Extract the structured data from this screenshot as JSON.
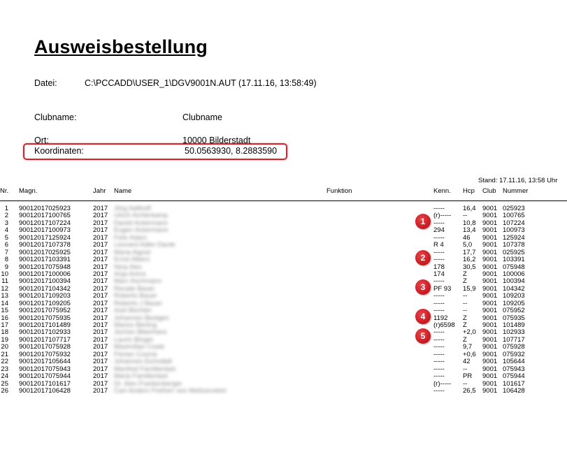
{
  "document": {
    "title": "Ausweisbestellung",
    "datei_label": "Datei:",
    "datei_value": "C:\\PCCADD\\USER_1\\DGV9001N.AUT (17.11.16, 13:58:49)",
    "clubname_label": "Clubname:",
    "clubname_value": "Clubname",
    "ort_label": "Ort:",
    "ort_value": "10000 Bilderstadt",
    "koordinaten_label": "Koordinaten:",
    "koordinaten_value": "50.0563930, 8.2883590",
    "stand": "Stand: 17.11.16, 13:58 Uhr"
  },
  "highlight_color": "#d8222a",
  "table": {
    "headers": {
      "nr": "Nr.",
      "magn": "Magn.",
      "jahr": "Jahr",
      "name": "Name",
      "funktion": "Funktion",
      "kenn": "Kenn.",
      "hcp": "Hcp",
      "club": "Club",
      "nummer": "Nummer"
    },
    "rows": [
      {
        "nr": "1",
        "magn": "90012017025923",
        "jahr": "2017",
        "name": "Jörg Aalthoff",
        "kenn": "-----",
        "hcp": "16,4",
        "club": "9001",
        "nummer": "025923"
      },
      {
        "nr": "2",
        "magn": "90012017100765",
        "jahr": "2017",
        "name": "Ulrich Achterkamp",
        "kenn": "(r)-----",
        "hcp": "--",
        "club": "9001",
        "nummer": "100765"
      },
      {
        "nr": "3",
        "magn": "90012017107224",
        "jahr": "2017",
        "name": "Daniel Ackermann",
        "kenn": "-----",
        "hcp": "10,8",
        "club": "9001",
        "nummer": "107224"
      },
      {
        "nr": "4",
        "magn": "90012017100973",
        "jahr": "2017",
        "name": "Eugen Ackermann",
        "kenn": "294",
        "hcp": "13,4",
        "club": "9001",
        "nummer": "100973"
      },
      {
        "nr": "5",
        "magn": "90012017125924",
        "jahr": "2017",
        "name": "Felix Adam",
        "kenn": "-----",
        "hcp": "46",
        "club": "9001",
        "nummer": "125924"
      },
      {
        "nr": "6",
        "magn": "90012017107378",
        "jahr": "2017",
        "name": "Leonard Adler-Dante",
        "kenn": "R 4",
        "hcp": "5,0",
        "club": "9001",
        "nummer": "107378"
      },
      {
        "nr": "7",
        "magn": "90012017025925",
        "jahr": "2017",
        "name": "Maria Aigner",
        "kenn": "-----",
        "hcp": "17,7",
        "club": "9001",
        "nummer": "025925"
      },
      {
        "nr": "8",
        "magn": "90012017103391",
        "jahr": "2017",
        "name": "Ernst Albers",
        "kenn": "-----",
        "hcp": "16,2",
        "club": "9001",
        "nummer": "103391"
      },
      {
        "nr": "9",
        "magn": "90012017075948",
        "jahr": "2017",
        "name": "Nina Alex",
        "kenn": "178",
        "hcp": "30,5",
        "club": "9001",
        "nummer": "075948"
      },
      {
        "nr": "10",
        "magn": "90012017100006",
        "jahr": "2017",
        "name": "Anja Arens",
        "kenn": "174",
        "hcp": "Z",
        "club": "9001",
        "nummer": "100006"
      },
      {
        "nr": "11",
        "magn": "90012017100394",
        "jahr": "2017",
        "name": "Marc Aschmann",
        "kenn": "-----",
        "hcp": "Z",
        "club": "9001",
        "nummer": "100394"
      },
      {
        "nr": "12",
        "magn": "90012017104342",
        "jahr": "2017",
        "name": "Renate Bauer",
        "kenn": "PF 93",
        "hcp": "15,9",
        "club": "9001",
        "nummer": "104342"
      },
      {
        "nr": "13",
        "magn": "90012017109203",
        "jahr": "2017",
        "name": "Roberto Bauer",
        "kenn": "-----",
        "hcp": "--",
        "club": "9001",
        "nummer": "109203"
      },
      {
        "nr": "14",
        "magn": "90012017109205",
        "jahr": "2017",
        "name": "Roberto J Bauer",
        "kenn": "-----",
        "hcp": "--",
        "club": "9001",
        "nummer": "109205"
      },
      {
        "nr": "15",
        "magn": "90012017075952",
        "jahr": "2017",
        "name": "Axel Bechter",
        "kenn": "-----",
        "hcp": "--",
        "club": "9001",
        "nummer": "075952"
      },
      {
        "nr": "16",
        "magn": "90012017075935",
        "jahr": "2017",
        "name": "Johannes Beelgen",
        "kenn": "1192",
        "hcp": "Z",
        "club": "9001",
        "nummer": "075935"
      },
      {
        "nr": "17",
        "magn": "90012017101489",
        "jahr": "2017",
        "name": "Marion Berling",
        "kenn": "(r)6598",
        "hcp": "Z",
        "club": "9001",
        "nummer": "101489"
      },
      {
        "nr": "18",
        "magn": "90012017102933",
        "jahr": "2017",
        "name": "Jochen Bikerhans",
        "kenn": "-----",
        "hcp": "+2,0",
        "club": "9001",
        "nummer": "102933"
      },
      {
        "nr": "19",
        "magn": "90012017107717",
        "jahr": "2017",
        "name": "Laurin Binger",
        "kenn": "-----",
        "hcp": "Z",
        "club": "9001",
        "nummer": "107717"
      },
      {
        "nr": "20",
        "magn": "90012017075928",
        "jahr": "2017",
        "name": "Maximilian Coste",
        "kenn": "-----",
        "hcp": "9,7",
        "club": "9001",
        "nummer": "075928"
      },
      {
        "nr": "21",
        "magn": "90012017075932",
        "jahr": "2017",
        "name": "Florian Cosme",
        "kenn": "-----",
        "hcp": "+0,6",
        "club": "9001",
        "nummer": "075932"
      },
      {
        "nr": "22",
        "magn": "90012017105644",
        "jahr": "2017",
        "name": "Johannes Eichstädt",
        "kenn": "-----",
        "hcp": "42",
        "club": "9001",
        "nummer": "105644"
      },
      {
        "nr": "23",
        "magn": "90012017075943",
        "jahr": "2017",
        "name": "Manfred Familienlast",
        "kenn": "-----",
        "hcp": "--",
        "club": "9001",
        "nummer": "075943"
      },
      {
        "nr": "24",
        "magn": "90012017075944",
        "jahr": "2017",
        "name": "Maria Familienlast",
        "kenn": "-----",
        "hcp": "PR",
        "club": "9001",
        "nummer": "075944"
      },
      {
        "nr": "25",
        "magn": "90012017101617",
        "jahr": "2017",
        "name": "Dr. Alex Frankenberger",
        "kenn": "(r)-----",
        "hcp": "--",
        "club": "9001",
        "nummer": "101617"
      },
      {
        "nr": "26",
        "magn": "90012017106428",
        "jahr": "2017",
        "name": "Carl-Anders Freiherr von Mettzenstein",
        "kenn": "-----",
        "hcp": "26,5",
        "club": "9001",
        "nummer": "106428"
      }
    ]
  },
  "markers": [
    "1",
    "2",
    "3",
    "4",
    "5"
  ]
}
